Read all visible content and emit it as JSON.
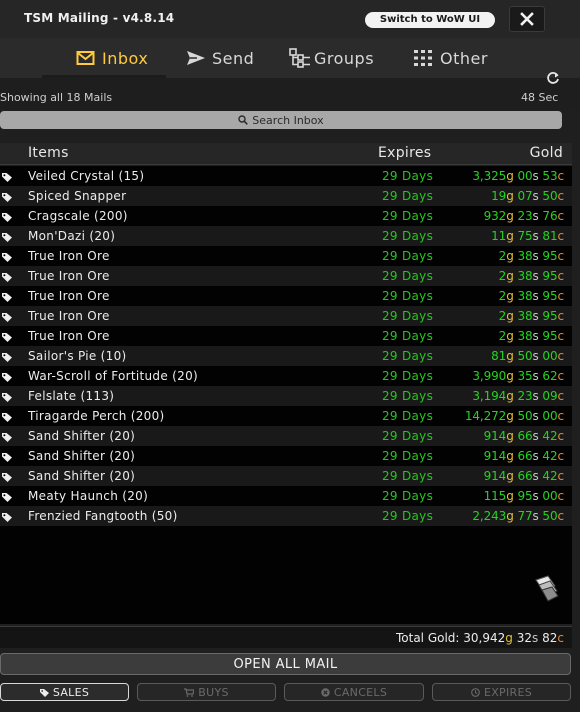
{
  "window": {
    "title": "TSM Mailing - v4.8.14",
    "switch_label": "Switch to WoW UI"
  },
  "tabs": [
    {
      "label": "Inbox",
      "icon": "envelope-icon",
      "active": true
    },
    {
      "label": "Send",
      "icon": "send-icon"
    },
    {
      "label": "Groups",
      "icon": "groups-icon"
    },
    {
      "label": "Other",
      "icon": "grid-icon"
    }
  ],
  "inbox": {
    "showing": "Showing all 18 Mails",
    "timer": "48 Sec",
    "search_placeholder": "Search Inbox"
  },
  "columns": {
    "items": "Items",
    "expires": "Expires",
    "gold": "Gold"
  },
  "colors": {
    "accent": "#ffcb3d",
    "expires_green": "#26c61f",
    "gold": "#e8bf2f",
    "silver": "#c8c8c8",
    "copper": "#e08a3a"
  },
  "rows": [
    {
      "item": "Veiled Crystal (15)",
      "expires": "29 Days",
      "g": "3,325",
      "s": "00",
      "c": "53"
    },
    {
      "item": "Spiced Snapper",
      "expires": "29 Days",
      "g": "19",
      "s": "07",
      "c": "50"
    },
    {
      "item": "Cragscale (200)",
      "expires": "29 Days",
      "g": "932",
      "s": "23",
      "c": "76"
    },
    {
      "item": "Mon'Dazi (20)",
      "expires": "29 Days",
      "g": "11",
      "s": "75",
      "c": "81"
    },
    {
      "item": "True Iron Ore",
      "expires": "29 Days",
      "g": "2",
      "s": "38",
      "c": "95"
    },
    {
      "item": "True Iron Ore",
      "expires": "29 Days",
      "g": "2",
      "s": "38",
      "c": "95"
    },
    {
      "item": "True Iron Ore",
      "expires": "29 Days",
      "g": "2",
      "s": "38",
      "c": "95"
    },
    {
      "item": "True Iron Ore",
      "expires": "29 Days",
      "g": "2",
      "s": "38",
      "c": "95"
    },
    {
      "item": "True Iron Ore",
      "expires": "29 Days",
      "g": "2",
      "s": "38",
      "c": "95"
    },
    {
      "item": "Sailor's Pie (10)",
      "expires": "29 Days",
      "g": "81",
      "s": "50",
      "c": "00"
    },
    {
      "item": "War-Scroll of Fortitude (20)",
      "expires": "29 Days",
      "g": "3,990",
      "s": "35",
      "c": "62"
    },
    {
      "item": "Felslate (113)",
      "expires": "29 Days",
      "g": "3,194",
      "s": "23",
      "c": "09"
    },
    {
      "item": "Tiragarde Perch (200)",
      "expires": "29 Days",
      "g": "14,272",
      "s": "50",
      "c": "00"
    },
    {
      "item": "Sand Shifter (20)",
      "expires": "29 Days",
      "g": "914",
      "s": "66",
      "c": "42"
    },
    {
      "item": "Sand Shifter (20)",
      "expires": "29 Days",
      "g": "914",
      "s": "66",
      "c": "42"
    },
    {
      "item": "Sand Shifter (20)",
      "expires": "29 Days",
      "g": "914",
      "s": "66",
      "c": "42"
    },
    {
      "item": "Meaty Haunch (20)",
      "expires": "29 Days",
      "g": "115",
      "s": "95",
      "c": "00"
    },
    {
      "item": "Frenzied Fangtooth (50)",
      "expires": "29 Days",
      "g": "2,243",
      "s": "77",
      "c": "50"
    }
  ],
  "footer": {
    "total_label": "Total Gold: ",
    "total_g": "30,942",
    "total_s": "32",
    "total_c": "82",
    "open_all": "OPEN ALL MAIL",
    "filters": [
      {
        "label": "SALES",
        "icon": "tag-icon",
        "active": true
      },
      {
        "label": "BUYS",
        "icon": "cart-icon"
      },
      {
        "label": "CANCELS",
        "icon": "cancel-icon"
      },
      {
        "label": "EXPIRES",
        "icon": "clock-icon"
      }
    ]
  }
}
